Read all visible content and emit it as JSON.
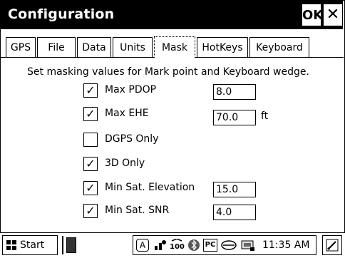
{
  "window": {
    "title": "Configuration",
    "ok_label": "OK",
    "close_label": "✕"
  },
  "tabs": [
    {
      "label": "GPS",
      "active": false
    },
    {
      "label": "File",
      "active": false
    },
    {
      "label": "Data",
      "active": false
    },
    {
      "label": "Units",
      "active": false
    },
    {
      "label": "Mask",
      "active": true
    },
    {
      "label": "HotKeys",
      "active": false
    },
    {
      "label": "Keyboard",
      "active": false
    }
  ],
  "mask": {
    "description": "Set masking values for Mark point and Keyboard wedge.",
    "options": [
      {
        "label": "Max PDOP",
        "checked": true,
        "value": "8.0",
        "unit": ""
      },
      {
        "label": "Max EHE",
        "checked": true,
        "value": "70.0",
        "unit": "ft"
      },
      {
        "label": "DGPS Only",
        "checked": false
      },
      {
        "label": "3D Only",
        "checked": true
      },
      {
        "label": "Min Sat. Elevation",
        "checked": true,
        "value": "15.0",
        "unit": ""
      },
      {
        "label": "Min Sat. SNR",
        "checked": true,
        "value": "4.0",
        "unit": ""
      }
    ],
    "check_glyph": "✓"
  },
  "taskbar": {
    "start_label": "Start",
    "tray_a": "A",
    "tray_pc": "PC",
    "clock": "11:35 AM",
    "icons": [
      "start-flag-icon",
      "app-icon",
      "input-a-icon",
      "network-icon",
      "gps-100-icon",
      "bluetooth-icon",
      "pc-icon",
      "connection-icon",
      "keyboard-icon",
      "sip-pen-icon"
    ]
  }
}
